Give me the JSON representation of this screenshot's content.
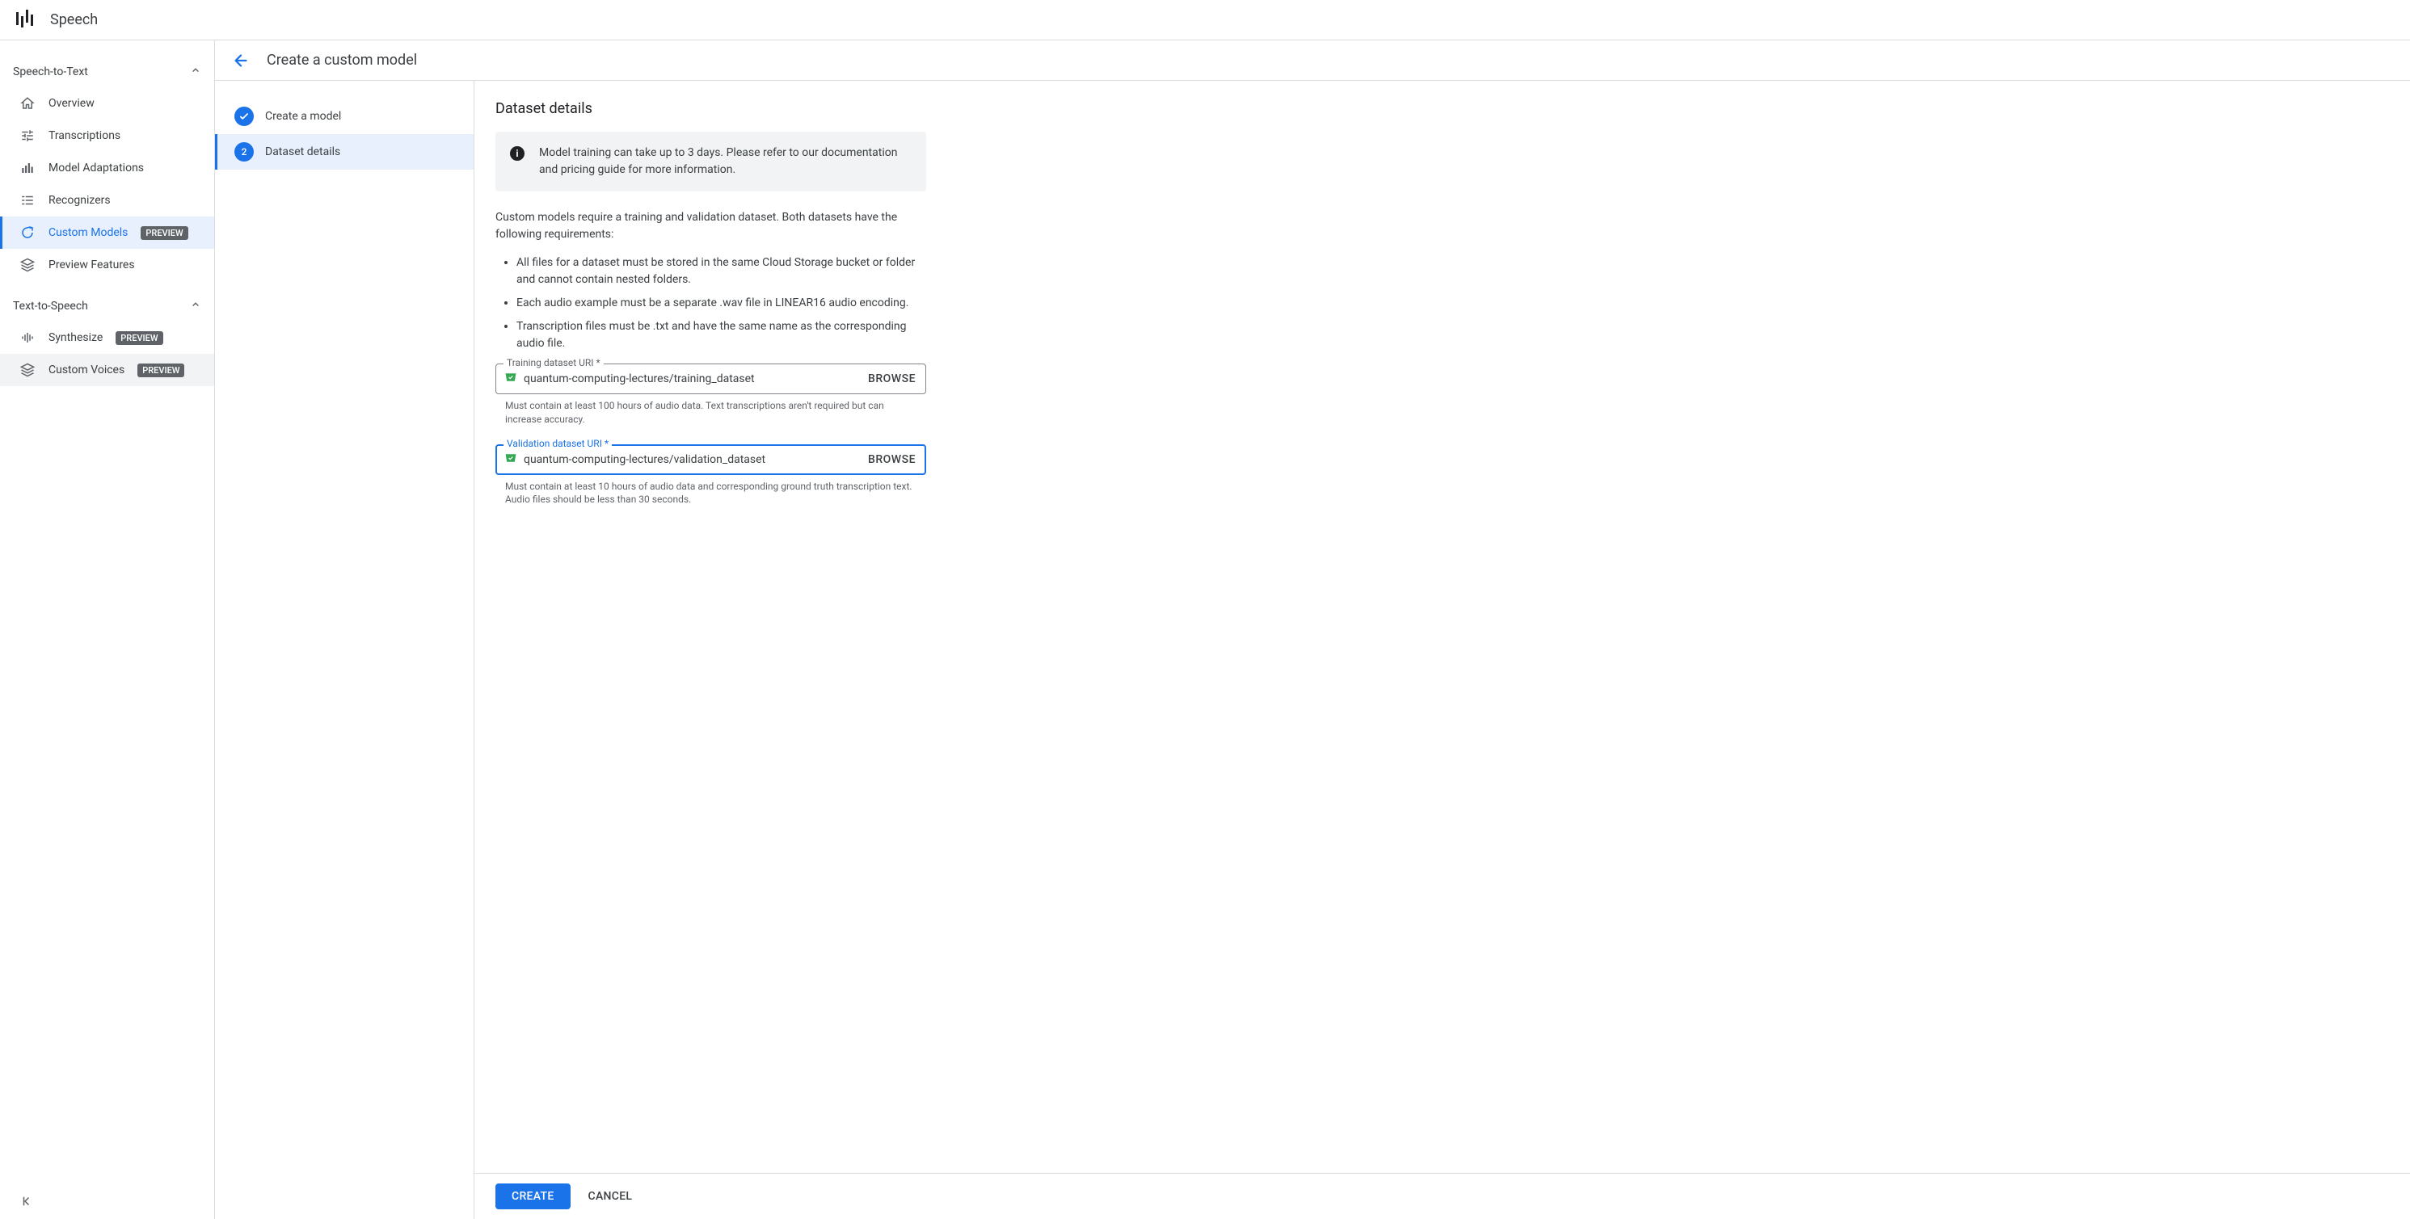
{
  "app": {
    "title": "Speech"
  },
  "sidebar": {
    "groups": [
      {
        "label": "Speech-to-Text",
        "items": [
          {
            "label": "Overview",
            "icon": "home"
          },
          {
            "label": "Transcriptions",
            "icon": "tune"
          },
          {
            "label": "Model Adaptations",
            "icon": "bars"
          },
          {
            "label": "Recognizers",
            "icon": "list"
          },
          {
            "label": "Custom Models",
            "icon": "loop",
            "badge": "PREVIEW",
            "active": true
          },
          {
            "label": "Preview Features",
            "icon": "layers"
          }
        ]
      },
      {
        "label": "Text-to-Speech",
        "items": [
          {
            "label": "Synthesize",
            "icon": "equalizer",
            "badge": "PREVIEW"
          },
          {
            "label": "Custom Voices",
            "icon": "layers",
            "badge": "PREVIEW",
            "hover": true
          }
        ]
      }
    ]
  },
  "page": {
    "title": "Create a custom model",
    "steps": [
      {
        "label": "Create a model",
        "done": true
      },
      {
        "label": "Dataset details",
        "number": "2",
        "active": true
      }
    ]
  },
  "form": {
    "title": "Dataset details",
    "info": "Model training can take up to 3 days. Please refer to our documentation and pricing guide for more information.",
    "description": "Custom models require a training and validation dataset. Both datasets have the following requirements:",
    "requirements": [
      "All files for a dataset must be stored in the same Cloud Storage bucket or folder and cannot contain nested folders.",
      "Each audio example must be a separate .wav file in LINEAR16 audio encoding.",
      "Transcription files must be .txt and have the same name as the corresponding audio file."
    ],
    "training": {
      "label": "Training dataset URI *",
      "value": "quantum-computing-lectures/training_dataset",
      "browse": "BROWSE",
      "helper": "Must contain at least 100 hours of audio data. Text transcriptions aren't required but can increase accuracy."
    },
    "validation": {
      "label": "Validation dataset URI *",
      "value": "quantum-computing-lectures/validation_dataset",
      "browse": "BROWSE",
      "helper": "Must contain at least 10 hours of audio data and corresponding ground truth transcription text. Audio files should be less than 30 seconds."
    }
  },
  "footer": {
    "primary": "CREATE",
    "cancel": "CANCEL"
  }
}
